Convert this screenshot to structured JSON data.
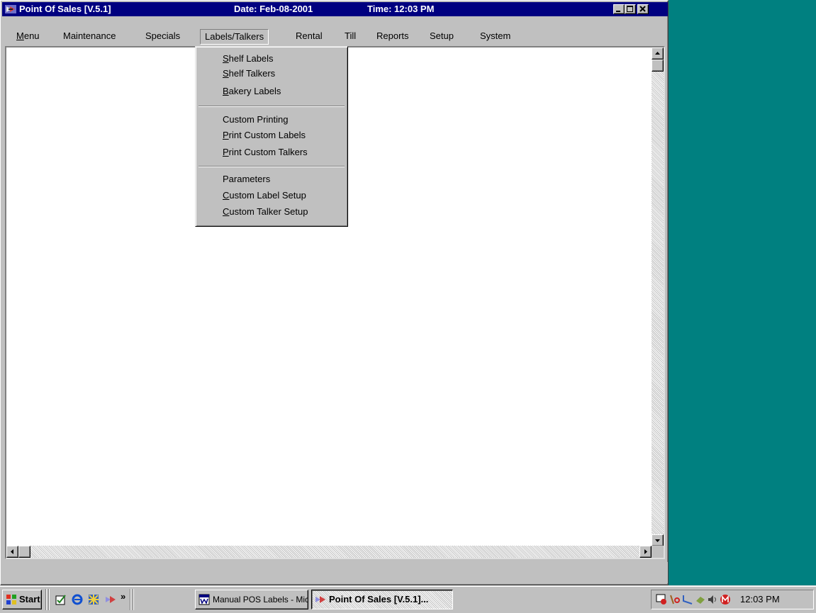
{
  "window": {
    "title": "Point Of Sales [V.5.1]",
    "date_text": "Date: Feb-08-2001",
    "time_text": "Time: 12:03 PM",
    "controls": [
      "minimize-icon",
      "maximize-icon",
      "close-icon"
    ]
  },
  "menubar": {
    "items": [
      {
        "label": "Menu",
        "underline": "M"
      },
      {
        "label": "Maintenance"
      },
      {
        "label": "Specials"
      },
      {
        "label": "Labels/Talkers",
        "open": true
      },
      {
        "label": "Rental"
      },
      {
        "label": "Till"
      },
      {
        "label": "Reports"
      },
      {
        "label": "Setup"
      },
      {
        "label": "System"
      }
    ]
  },
  "dropdown": {
    "groups": [
      [
        {
          "pre": "",
          "u": "S",
          "rest": "helf Labels"
        },
        {
          "pre": "",
          "u": "S",
          "rest": "helf Talkers"
        },
        {
          "pre": "",
          "u": "B",
          "rest": "akery Labels"
        }
      ],
      [
        {
          "pre": "Custom Printing",
          "u": "",
          "rest": ""
        },
        {
          "pre": "",
          "u": "P",
          "rest": "rint Custom Labels"
        },
        {
          "pre": "",
          "u": "P",
          "rest": "rint Custom Talkers"
        }
      ],
      [
        {
          "pre": "Parameters",
          "u": "",
          "rest": ""
        },
        {
          "pre": "",
          "u": "C",
          "rest": "ustom Label Setup"
        },
        {
          "pre": "",
          "u": "C",
          "rest": "ustom Talker Setup"
        }
      ]
    ]
  },
  "taskbar": {
    "start_label": "Start",
    "quick_launch": [
      "check-edit-icon",
      "internet-explorer-icon",
      "network-icon",
      "pos-app-icon"
    ],
    "overflow_label": "»",
    "tasks": [
      {
        "label": "Manual POS Labels - Micr...",
        "icon": "word-document-icon",
        "active": false
      },
      {
        "label": "Point Of Sales [V.5.1]...",
        "icon": "pos-app-icon",
        "active": true
      }
    ],
    "tray_icons": [
      "scheduler-icon",
      "security-icon",
      "phone-icon",
      "network-link-icon",
      "volume-icon",
      "mcafee-icon"
    ],
    "clock": "12:03 PM"
  },
  "colors": {
    "desktop": "#008080",
    "titlebar": "#000080",
    "face": "#c0c0c0"
  }
}
